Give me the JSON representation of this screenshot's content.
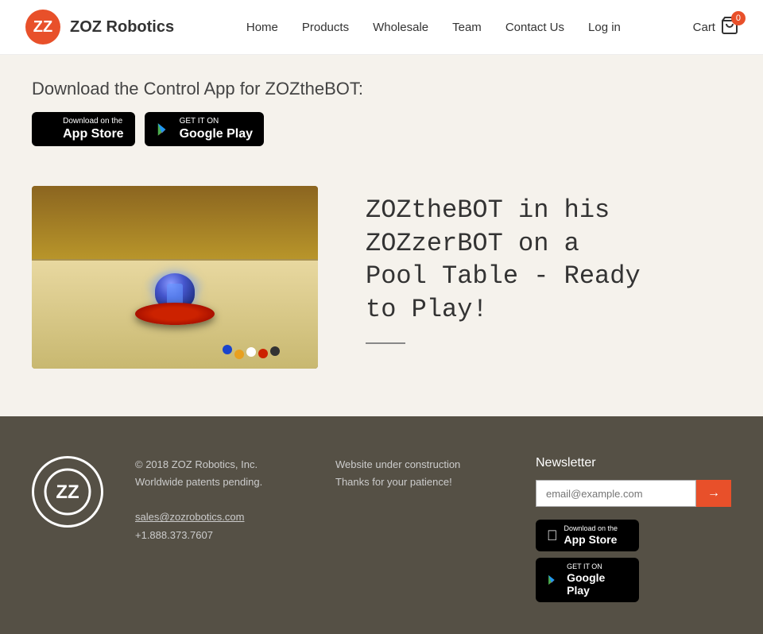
{
  "header": {
    "logo_text": "ZOZ Robotics",
    "nav": {
      "home": "Home",
      "products": "Products",
      "wholesale": "Wholesale",
      "team": "Team",
      "contact": "Contact Us",
      "login": "Log in",
      "cart": "Cart",
      "cart_count": "0"
    }
  },
  "main": {
    "download_heading": "Download the Control App for ZOZtheBOT:",
    "app_store": {
      "top": "Download on the",
      "main": "App Store"
    },
    "google_play": {
      "top": "GET IT ON",
      "main": "Google Play"
    },
    "product_title": "ZOZtheBOT in his ZOZzerBOT on a Pool Table - Ready to Play!"
  },
  "footer": {
    "copyright": "© 2018 ZOZ Robotics, Inc.",
    "patents": "Worldwide patents pending.",
    "email": "sales@zozrobotics.com",
    "phone": "+1.888.373.7607",
    "website_line1": "Website under construction",
    "website_line2": "Thanks for your patience!",
    "newsletter_title": "Newsletter",
    "newsletter_placeholder": "email@example.com",
    "app_store": {
      "top": "Download on the",
      "main": "App Store"
    },
    "google_play": {
      "top": "GET IT ON",
      "main": "Google Play"
    }
  },
  "colors": {
    "accent": "#e8502a",
    "dark_bg": "#555045",
    "light_bg": "#f5f2ec"
  }
}
